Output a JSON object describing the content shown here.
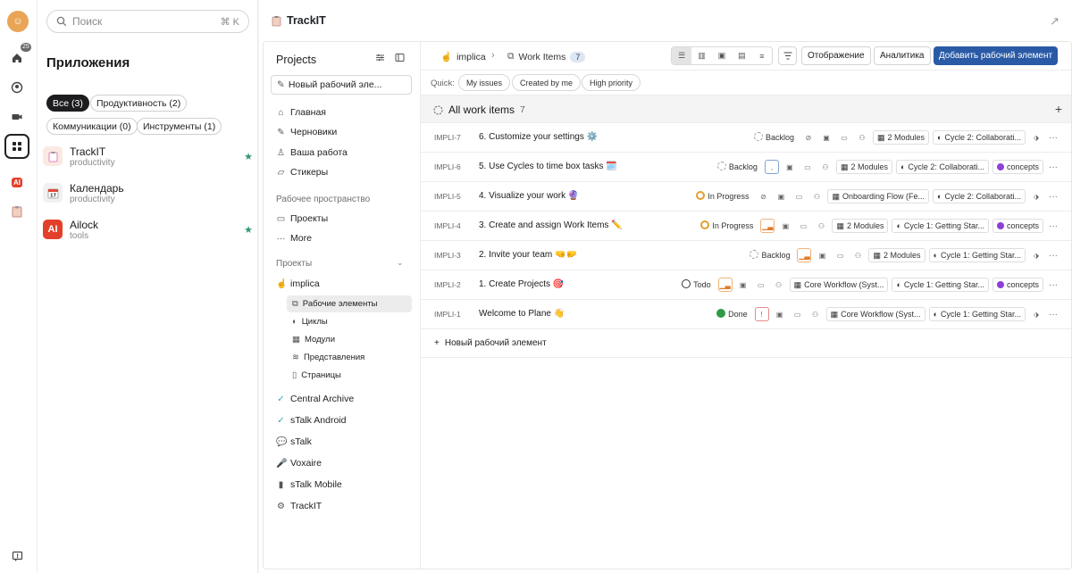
{
  "rail": {
    "badge": "25",
    "icons": [
      "home-icon",
      "user-circle-icon",
      "video-icon",
      "apps-grid-icon",
      "ailock-icon",
      "clipboard-icon",
      "feedback-icon"
    ]
  },
  "apps": {
    "search_placeholder": "Поиск",
    "search_shortcut": "⌘ K",
    "title": "Приложения",
    "chips": [
      "Все (3)",
      "Продуктивность (2)",
      "Коммуникации (0)",
      "Инструменты (1)"
    ],
    "items": [
      {
        "name": "TrackIT",
        "category": "productivity",
        "starred": true
      },
      {
        "name": "Календарь",
        "category": "productivity",
        "starred": false
      },
      {
        "name": "Ailock",
        "category": "tools",
        "starred": true
      }
    ]
  },
  "window": {
    "title": "TrackIT"
  },
  "projects": {
    "header": "Projects",
    "new_item": "Новый рабочий эле...",
    "nav": [
      "Главная",
      "Черновики",
      "Ваша работа",
      "Стикеры"
    ],
    "workspace_label": "Рабочее пространство",
    "workspace_items": [
      "Проекты",
      "More"
    ],
    "projects_label": "Проекты",
    "current_project": "implica",
    "sub_items": [
      "Рабочие элементы",
      "Циклы",
      "Модули",
      "Представления",
      "Страницы"
    ],
    "other_projects": [
      "Central Archive",
      "sTalk Android",
      "sTalk",
      "Voxaire",
      "sTalk Mobile",
      "TrackIT"
    ]
  },
  "toolbar": {
    "project": "implica",
    "page": "Work Items",
    "count": "7",
    "display_button": "Отображение",
    "analytics_button": "Аналитика",
    "add_button": "Добавить рабочий элемент"
  },
  "quick": {
    "label": "Quick:",
    "filters": [
      "My issues",
      "Created by me",
      "High priority"
    ]
  },
  "group": {
    "title": "All work items",
    "count": "7"
  },
  "rows": [
    {
      "id": "IMPLI-7",
      "title": "6. Customize your settings ⚙️",
      "state": "Backlog",
      "state_icon": "backlog",
      "modules": "2 Modules",
      "cycle": "Cycle 2: Collaborati...",
      "label": ""
    },
    {
      "id": "IMPLI-6",
      "title": "5. Use Cycles to time box tasks 🗓️",
      "state": "Backlog",
      "state_icon": "backlog",
      "priority": ",",
      "modules": "2 Modules",
      "cycle": "Cycle 2: Collaborati...",
      "label": "concepts"
    },
    {
      "id": "IMPLI-5",
      "title": "4. Visualize your work 🔮",
      "state": "In Progress",
      "state_icon": "progress",
      "modules": "Onboarding Flow (Fe...",
      "cycle": "Cycle 2: Collaborati...",
      "label": ""
    },
    {
      "id": "IMPLI-4",
      "title": "3. Create and assign Work Items ✏️",
      "state": "In Progress",
      "state_icon": "progress",
      "modules": "2 Modules",
      "cycle": "Cycle 1: Getting Star...",
      "label": "concepts"
    },
    {
      "id": "IMPLI-3",
      "title": "2. Invite your team 🤜🤛",
      "state": "Backlog",
      "state_icon": "backlog",
      "modules": "2 Modules",
      "cycle": "Cycle 1: Getting Star...",
      "label": ""
    },
    {
      "id": "IMPLI-2",
      "title": "1. Create Projects 🎯",
      "state": "Todo",
      "state_icon": "todo",
      "modules": "Core Workflow (Syst...",
      "cycle": "Cycle 1: Getting Star...",
      "label": "concepts"
    },
    {
      "id": "IMPLI-1",
      "title": "Welcome to Plane 👋",
      "state": "Done",
      "state_icon": "done",
      "modules": "Core Workflow (Syst...",
      "cycle": "Cycle 1: Getting Star...",
      "label": ""
    }
  ],
  "add_row": "Новый рабочий элемент",
  "colors": {
    "primary": "#2a5aa6",
    "label_dot": "#8e3fd8",
    "done": "#2e9a48",
    "progress": "#e0a030"
  }
}
